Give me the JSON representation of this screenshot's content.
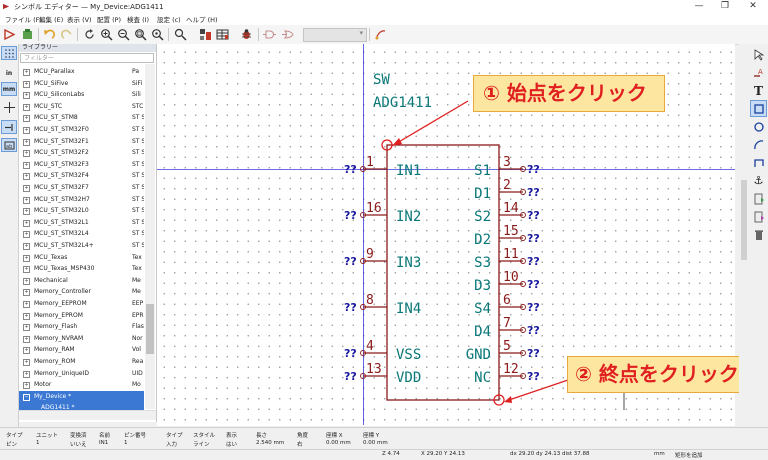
{
  "window": {
    "title": "シンボル エディター — My_Device:ADG1411",
    "minimize": "—",
    "maximize": "❐",
    "close": "✕"
  },
  "menu": [
    "ファイル (F)",
    "編集 (E)",
    "表示 (V)",
    "配置 (P)",
    "検査 (I)",
    "設定 (c)",
    "ヘルプ (H)"
  ],
  "toolbar": {
    "unit_select": ""
  },
  "left_tools": [
    "in",
    "mm"
  ],
  "library": {
    "title": "ライブラリー",
    "filter_placeholder": "フィルター",
    "rows": [
      {
        "name": "MCU_Parallax",
        "desc": "Pa"
      },
      {
        "name": "MCU_SiFive",
        "desc": "SiFi"
      },
      {
        "name": "MCU_SiliconLabs",
        "desc": "Sili"
      },
      {
        "name": "MCU_STC",
        "desc": "STC"
      },
      {
        "name": "MCU_ST_STM8",
        "desc": "ST S"
      },
      {
        "name": "MCU_ST_STM32F0",
        "desc": "ST S"
      },
      {
        "name": "MCU_ST_STM32F1",
        "desc": "ST S"
      },
      {
        "name": "MCU_ST_STM32F2",
        "desc": "ST S"
      },
      {
        "name": "MCU_ST_STM32F3",
        "desc": "ST S"
      },
      {
        "name": "MCU_ST_STM32F4",
        "desc": "ST S"
      },
      {
        "name": "MCU_ST_STM32F7",
        "desc": "ST S"
      },
      {
        "name": "MCU_ST_STM32H7",
        "desc": "ST S"
      },
      {
        "name": "MCU_ST_STM32L0",
        "desc": "ST S"
      },
      {
        "name": "MCU_ST_STM32L1",
        "desc": "ST S"
      },
      {
        "name": "MCU_ST_STM32L4",
        "desc": "ST S"
      },
      {
        "name": "MCU_ST_STM32L4+",
        "desc": "ST S"
      },
      {
        "name": "MCU_Texas",
        "desc": "Tex"
      },
      {
        "name": "MCU_Texas_MSP430",
        "desc": "Tex"
      },
      {
        "name": "Mechanical",
        "desc": "Me"
      },
      {
        "name": "Memory_Controller",
        "desc": "Me"
      },
      {
        "name": "Memory_EEPROM",
        "desc": "EEP"
      },
      {
        "name": "Memory_EPROM",
        "desc": "EPR"
      },
      {
        "name": "Memory_Flash",
        "desc": "Flas"
      },
      {
        "name": "Memory_NVRAM",
        "desc": "Nor"
      },
      {
        "name": "Memory_RAM",
        "desc": "Vol"
      },
      {
        "name": "Memory_ROM",
        "desc": "Rea"
      },
      {
        "name": "Memory_UniqueID",
        "desc": "UID"
      },
      {
        "name": "Motor",
        "desc": "Mo"
      }
    ],
    "selected": "My_Device *",
    "selected_child": "ADG1411 *"
  },
  "symbol": {
    "reference": "SW",
    "value": "ADG1411",
    "unknown": "??",
    "left_pins": [
      {
        "num": "1",
        "name": "IN1"
      },
      {
        "num": "16",
        "name": "IN2"
      },
      {
        "num": "9",
        "name": "IN3"
      },
      {
        "num": "8",
        "name": "IN4"
      },
      {
        "num": "4",
        "name": "VSS"
      },
      {
        "num": "13",
        "name": "VDD"
      }
    ],
    "right_pins": [
      {
        "num": "3",
        "name": "S1"
      },
      {
        "num": "2",
        "name": "D1"
      },
      {
        "num": "14",
        "name": "S2"
      },
      {
        "num": "15",
        "name": "D2"
      },
      {
        "num": "11",
        "name": "S3"
      },
      {
        "num": "10",
        "name": "D3"
      },
      {
        "num": "6",
        "name": "S4"
      },
      {
        "num": "7",
        "name": "D4"
      },
      {
        "num": "5",
        "name": "GND"
      },
      {
        "num": "12",
        "name": "NC"
      }
    ]
  },
  "callouts": {
    "start": "① 始点をクリック",
    "end": "② 終点をクリック"
  },
  "info_panel": [
    {
      "label": "タイプ",
      "value": "ピン"
    },
    {
      "label": "ユニット",
      "value": "1"
    },
    {
      "label": "変換済",
      "value": "いいえ"
    },
    {
      "label": "名前",
      "value": "IN1"
    },
    {
      "label": "ピン番号",
      "value": "1"
    },
    {
      "label": "タイプ",
      "value": "入力"
    },
    {
      "label": "スタイル",
      "value": "ライン"
    },
    {
      "label": "表示",
      "value": "はい"
    },
    {
      "label": "長さ",
      "value": "2.540 mm"
    },
    {
      "label": "角度",
      "value": "右"
    },
    {
      "label": "座標 X",
      "value": "0.00 mm"
    },
    {
      "label": "座標 Y",
      "value": "0.00 mm"
    }
  ],
  "status": {
    "zoom": "Z 4.74",
    "coords": "X 29.20  Y 24.13",
    "delta": "dx 29.20  dy 24.13  dist 37.88",
    "units": "mm",
    "mode": "矩形を追加"
  },
  "colors": {
    "pin": "#8b1a1a",
    "pin_name": "#0a7878",
    "unknown": "#1a1aa0",
    "callout_bg": "#fde6a0",
    "callout_border": "#e6a93a",
    "highlight": "#e02020",
    "selected_row": "#3a78d4"
  }
}
